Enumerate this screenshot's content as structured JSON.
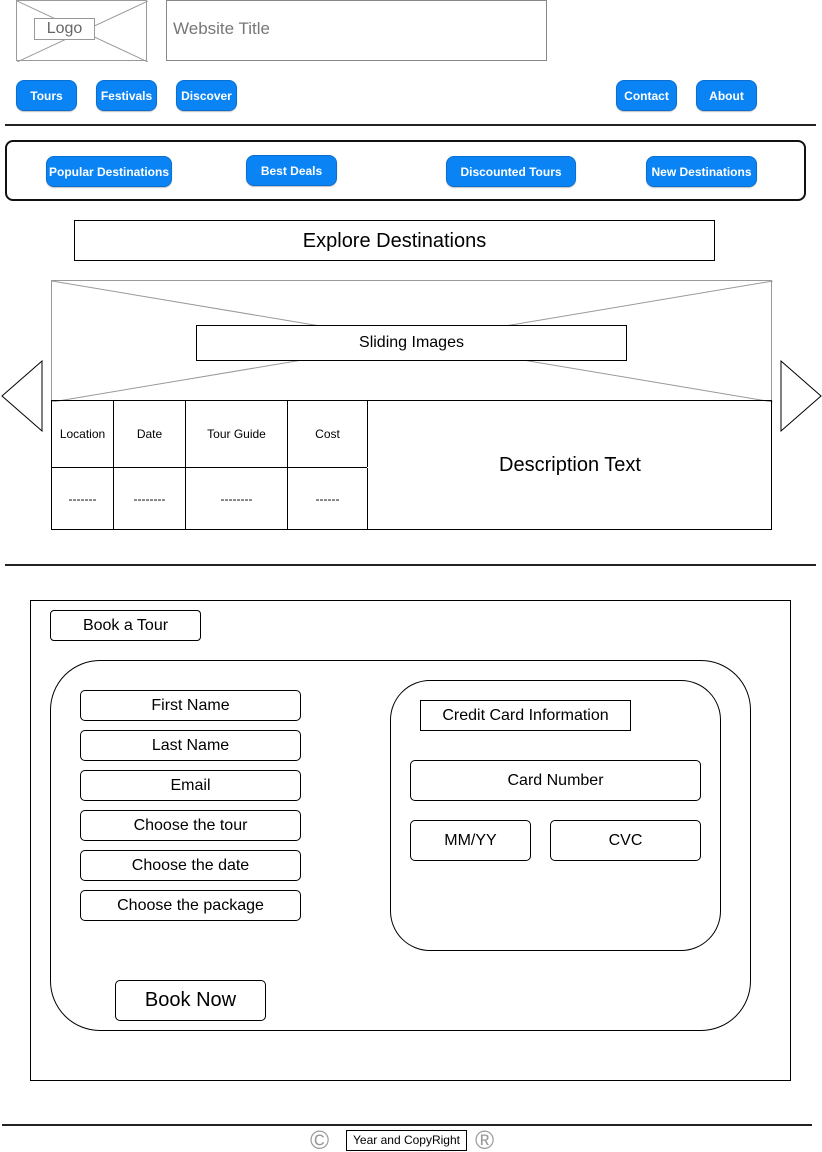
{
  "header": {
    "logo_label": "Logo",
    "title_placeholder": "Website Title"
  },
  "nav": {
    "left": [
      "Tours",
      "Festivals",
      "Discover"
    ],
    "right": [
      "Contact",
      "About"
    ]
  },
  "categories": [
    "Popular Destinations",
    "Best Deals",
    "Discounted Tours",
    "New Destinations"
  ],
  "explore": {
    "heading": "Explore Destinations",
    "slider_label": "Sliding Images"
  },
  "tour_table": {
    "headers": [
      "Location",
      "Date",
      "Tour Guide",
      "Cost"
    ],
    "values": [
      "-------",
      "--------",
      "--------",
      "------"
    ],
    "description": "Description Text"
  },
  "booking": {
    "tab_label": "Book a Tour",
    "fields": [
      "First Name",
      "Last Name",
      "Email",
      "Choose the tour",
      "Choose the date",
      "Choose the package"
    ],
    "credit_card": {
      "title": "Credit Card Information",
      "card_number": "Card Number",
      "expiry": "MM/YY",
      "cvc": "CVC"
    },
    "submit_label": "Book Now"
  },
  "footer": {
    "copyright_text": "Year and CopyRight",
    "copyright_symbol": "©",
    "registered_symbol": "®"
  },
  "colors": {
    "accent": "#0a84f5",
    "placeholder_stroke": "#999999"
  }
}
